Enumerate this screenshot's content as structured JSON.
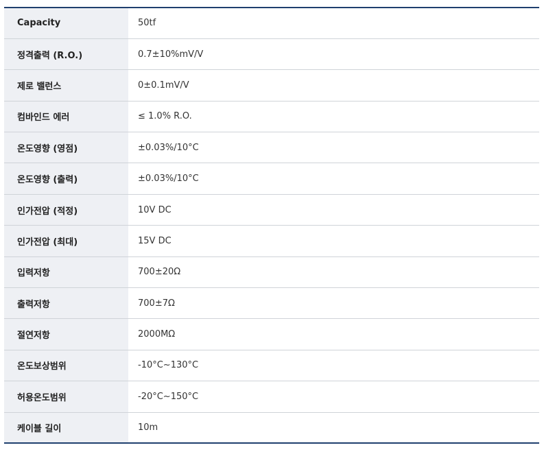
{
  "spec_table": {
    "rows": [
      {
        "label": "Capacity",
        "value": "50tf"
      },
      {
        "label": "정격출력 (R.O.)",
        "value": "0.7±10%mV/V"
      },
      {
        "label": "제로 밸런스",
        "value": "0±0.1mV/V"
      },
      {
        "label": "컴바인드 에러",
        "value": "≤ 1.0% R.O."
      },
      {
        "label": "온도영향 (영점)",
        "value": "±0.03%/10°C"
      },
      {
        "label": "온도영향 (출력)",
        "value": "±0.03%/10°C"
      },
      {
        "label": "인가전압 (적정)",
        "value": "10V DC"
      },
      {
        "label": "인가전압 (최대)",
        "value": "15V DC"
      },
      {
        "label": "입력저항",
        "value": "700±20Ω"
      },
      {
        "label": "출력저항",
        "value": "700±7Ω"
      },
      {
        "label": "절연저항",
        "value": "2000MΩ"
      },
      {
        "label": "온도보상범위",
        "value": "-10°C~130°C"
      },
      {
        "label": "허용온도범위",
        "value": "-20°C~150°C"
      },
      {
        "label": "케이블 길이",
        "value": "10m"
      }
    ]
  },
  "colors": {
    "header_border": "#1f3f6e",
    "label_background": "#eef0f4",
    "row_divider": "#cfd3d8"
  }
}
